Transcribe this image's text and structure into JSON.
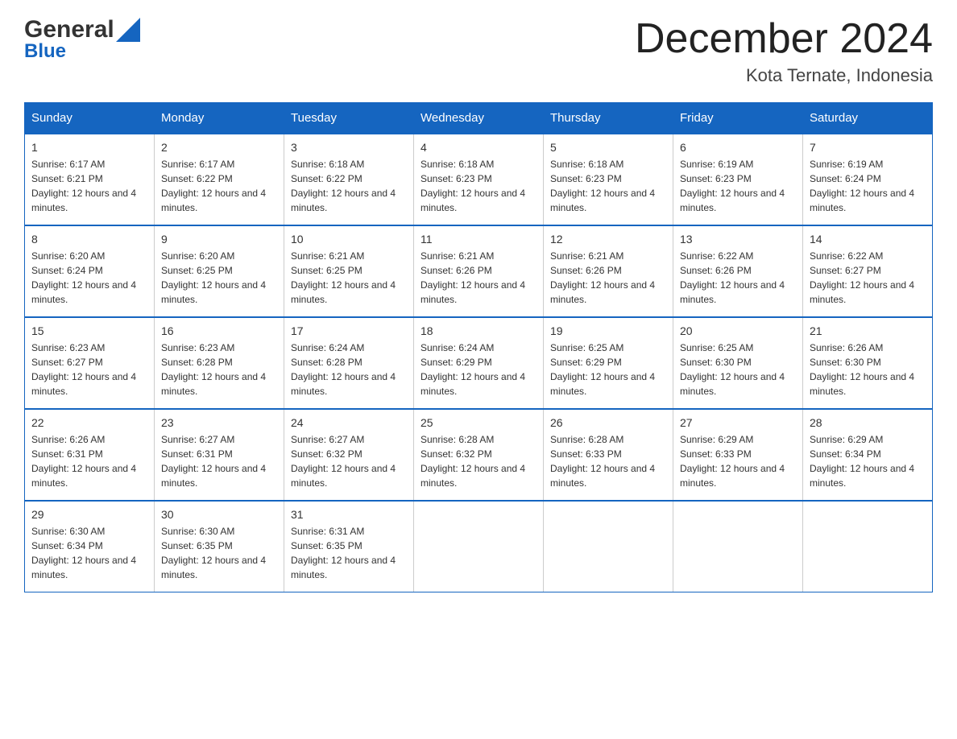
{
  "header": {
    "logo_general": "General",
    "logo_blue": "Blue",
    "month_title": "December 2024",
    "location": "Kota Ternate, Indonesia"
  },
  "days_of_week": [
    "Sunday",
    "Monday",
    "Tuesday",
    "Wednesday",
    "Thursday",
    "Friday",
    "Saturday"
  ],
  "weeks": [
    [
      {
        "day": "1",
        "sunrise": "6:17 AM",
        "sunset": "6:21 PM",
        "daylight": "12 hours and 4 minutes."
      },
      {
        "day": "2",
        "sunrise": "6:17 AM",
        "sunset": "6:22 PM",
        "daylight": "12 hours and 4 minutes."
      },
      {
        "day": "3",
        "sunrise": "6:18 AM",
        "sunset": "6:22 PM",
        "daylight": "12 hours and 4 minutes."
      },
      {
        "day": "4",
        "sunrise": "6:18 AM",
        "sunset": "6:23 PM",
        "daylight": "12 hours and 4 minutes."
      },
      {
        "day": "5",
        "sunrise": "6:18 AM",
        "sunset": "6:23 PM",
        "daylight": "12 hours and 4 minutes."
      },
      {
        "day": "6",
        "sunrise": "6:19 AM",
        "sunset": "6:23 PM",
        "daylight": "12 hours and 4 minutes."
      },
      {
        "day": "7",
        "sunrise": "6:19 AM",
        "sunset": "6:24 PM",
        "daylight": "12 hours and 4 minutes."
      }
    ],
    [
      {
        "day": "8",
        "sunrise": "6:20 AM",
        "sunset": "6:24 PM",
        "daylight": "12 hours and 4 minutes."
      },
      {
        "day": "9",
        "sunrise": "6:20 AM",
        "sunset": "6:25 PM",
        "daylight": "12 hours and 4 minutes."
      },
      {
        "day": "10",
        "sunrise": "6:21 AM",
        "sunset": "6:25 PM",
        "daylight": "12 hours and 4 minutes."
      },
      {
        "day": "11",
        "sunrise": "6:21 AM",
        "sunset": "6:26 PM",
        "daylight": "12 hours and 4 minutes."
      },
      {
        "day": "12",
        "sunrise": "6:21 AM",
        "sunset": "6:26 PM",
        "daylight": "12 hours and 4 minutes."
      },
      {
        "day": "13",
        "sunrise": "6:22 AM",
        "sunset": "6:26 PM",
        "daylight": "12 hours and 4 minutes."
      },
      {
        "day": "14",
        "sunrise": "6:22 AM",
        "sunset": "6:27 PM",
        "daylight": "12 hours and 4 minutes."
      }
    ],
    [
      {
        "day": "15",
        "sunrise": "6:23 AM",
        "sunset": "6:27 PM",
        "daylight": "12 hours and 4 minutes."
      },
      {
        "day": "16",
        "sunrise": "6:23 AM",
        "sunset": "6:28 PM",
        "daylight": "12 hours and 4 minutes."
      },
      {
        "day": "17",
        "sunrise": "6:24 AM",
        "sunset": "6:28 PM",
        "daylight": "12 hours and 4 minutes."
      },
      {
        "day": "18",
        "sunrise": "6:24 AM",
        "sunset": "6:29 PM",
        "daylight": "12 hours and 4 minutes."
      },
      {
        "day": "19",
        "sunrise": "6:25 AM",
        "sunset": "6:29 PM",
        "daylight": "12 hours and 4 minutes."
      },
      {
        "day": "20",
        "sunrise": "6:25 AM",
        "sunset": "6:30 PM",
        "daylight": "12 hours and 4 minutes."
      },
      {
        "day": "21",
        "sunrise": "6:26 AM",
        "sunset": "6:30 PM",
        "daylight": "12 hours and 4 minutes."
      }
    ],
    [
      {
        "day": "22",
        "sunrise": "6:26 AM",
        "sunset": "6:31 PM",
        "daylight": "12 hours and 4 minutes."
      },
      {
        "day": "23",
        "sunrise": "6:27 AM",
        "sunset": "6:31 PM",
        "daylight": "12 hours and 4 minutes."
      },
      {
        "day": "24",
        "sunrise": "6:27 AM",
        "sunset": "6:32 PM",
        "daylight": "12 hours and 4 minutes."
      },
      {
        "day": "25",
        "sunrise": "6:28 AM",
        "sunset": "6:32 PM",
        "daylight": "12 hours and 4 minutes."
      },
      {
        "day": "26",
        "sunrise": "6:28 AM",
        "sunset": "6:33 PM",
        "daylight": "12 hours and 4 minutes."
      },
      {
        "day": "27",
        "sunrise": "6:29 AM",
        "sunset": "6:33 PM",
        "daylight": "12 hours and 4 minutes."
      },
      {
        "day": "28",
        "sunrise": "6:29 AM",
        "sunset": "6:34 PM",
        "daylight": "12 hours and 4 minutes."
      }
    ],
    [
      {
        "day": "29",
        "sunrise": "6:30 AM",
        "sunset": "6:34 PM",
        "daylight": "12 hours and 4 minutes."
      },
      {
        "day": "30",
        "sunrise": "6:30 AM",
        "sunset": "6:35 PM",
        "daylight": "12 hours and 4 minutes."
      },
      {
        "day": "31",
        "sunrise": "6:31 AM",
        "sunset": "6:35 PM",
        "daylight": "12 hours and 4 minutes."
      },
      null,
      null,
      null,
      null
    ]
  ],
  "labels": {
    "sunrise_prefix": "Sunrise: ",
    "sunset_prefix": "Sunset: ",
    "daylight_prefix": "Daylight: "
  },
  "colors": {
    "header_bg": "#1565c0",
    "header_text": "#ffffff",
    "border": "#1565c0",
    "text": "#333333"
  }
}
